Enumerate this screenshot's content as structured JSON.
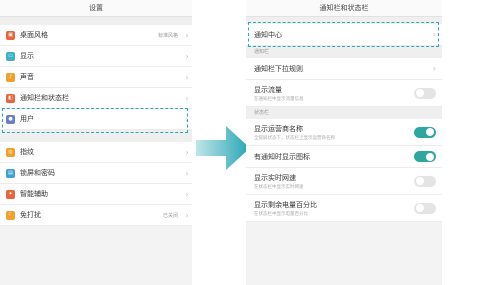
{
  "left": {
    "title": "设置",
    "items": [
      {
        "label": "桌面风格",
        "value": "标准风格",
        "icon": "desktop-style-icon",
        "color": "#e8643c"
      },
      {
        "label": "显示",
        "value": "",
        "icon": "display-icon",
        "color": "#3fb0c8"
      },
      {
        "label": "声音",
        "value": "",
        "icon": "sound-icon",
        "color": "#f0a02c"
      },
      {
        "label": "通知栏和状态栏",
        "value": "",
        "icon": "notification-icon",
        "color": "#e8643c"
      },
      {
        "label": "用户",
        "value": "",
        "icon": "user-icon",
        "color": "#6a7ec8"
      },
      {
        "label": "指纹",
        "value": "",
        "icon": "fingerprint-icon",
        "color": "#f0a02c"
      },
      {
        "label": "锁屏和密码",
        "value": "",
        "icon": "lock-icon",
        "color": "#3fa0d8"
      },
      {
        "label": "智能辅助",
        "value": "",
        "icon": "smart-assist-icon",
        "color": "#e8643c"
      },
      {
        "label": "免打扰",
        "value": "已关闭",
        "icon": "do-not-disturb-icon",
        "color": "#f0a02c"
      }
    ]
  },
  "right": {
    "title": "通知栏和状态栏",
    "notification_center": "通知中心",
    "section_notification": "通知栏",
    "dropdown_rule": "通知栏下拉规则",
    "show_traffic": "显示流量",
    "show_traffic_sub": "在通知栏中显示流量信息",
    "section_status": "状态栏",
    "carrier_name": "显示运营商名称",
    "carrier_name_sub": "全锁屏状态下，状态栏上显示运营商名称",
    "notif_icon": "有通知时显示图标",
    "realtime_speed": "显示实时网速",
    "realtime_speed_sub": "在状态栏中显示实时网速",
    "battery_percent": "显示剩余电量百分比",
    "battery_percent_sub": "在状态栏中显示电量百分比"
  },
  "toggles": {
    "show_traffic": "off",
    "carrier_name": "on",
    "notif_icon": "on",
    "realtime_speed": "off",
    "battery_percent": "off"
  },
  "colors": {
    "accent": "#2ea7b5",
    "toggle_on": "#2ea7a0"
  }
}
